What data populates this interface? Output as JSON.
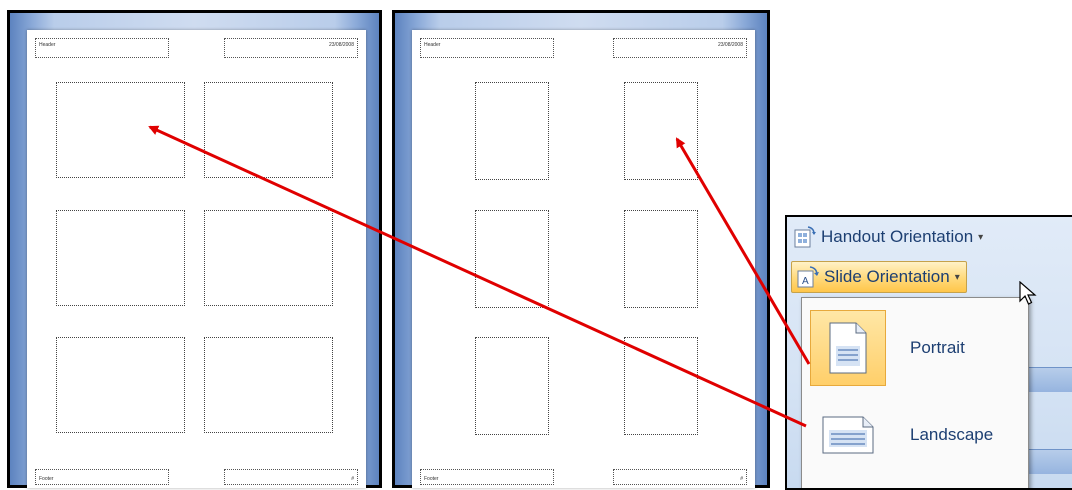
{
  "landscape_preview": {
    "header_text": "Header",
    "date_text": "23/08/2008",
    "footer_text": "Footer",
    "page_number": "#"
  },
  "portrait_preview": {
    "header_text": "Header",
    "date_text": "23/08/2008",
    "footer_text": "Footer",
    "page_number": "#"
  },
  "ribbon": {
    "handout_orientation_label": "Handout Orientation",
    "slide_orientation_label": "Slide Orientation",
    "menu": {
      "portrait_label": "Portrait",
      "landscape_label": "Landscape",
      "selected": "Portrait"
    }
  },
  "colors": {
    "arrow": "#e00000",
    "highlight": "#ffd97a",
    "ribbon_text": "#1d3f72"
  },
  "icons": [
    "handout-orientation-icon",
    "slide-orientation-icon",
    "portrait-page-icon",
    "landscape-page-icon",
    "mouse-pointer-icon"
  ]
}
